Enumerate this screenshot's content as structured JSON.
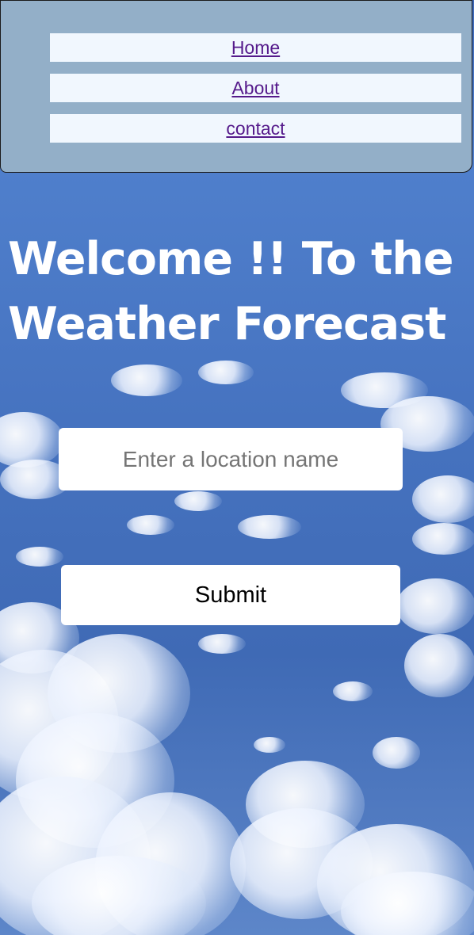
{
  "nav": {
    "items": [
      {
        "label": "Home"
      },
      {
        "label": "About"
      },
      {
        "label": "contact"
      }
    ],
    "background_color": "#93afc8",
    "item_background_color": "#f1f7fe",
    "link_color": "#551a8b"
  },
  "hero": {
    "title": "Welcome !! To the Weather Forecast"
  },
  "search": {
    "placeholder": "Enter a location name",
    "value": ""
  },
  "submit": {
    "label": "Submit"
  },
  "background": {
    "description_colors": [
      "#3d68b8",
      "#ffffff"
    ]
  }
}
